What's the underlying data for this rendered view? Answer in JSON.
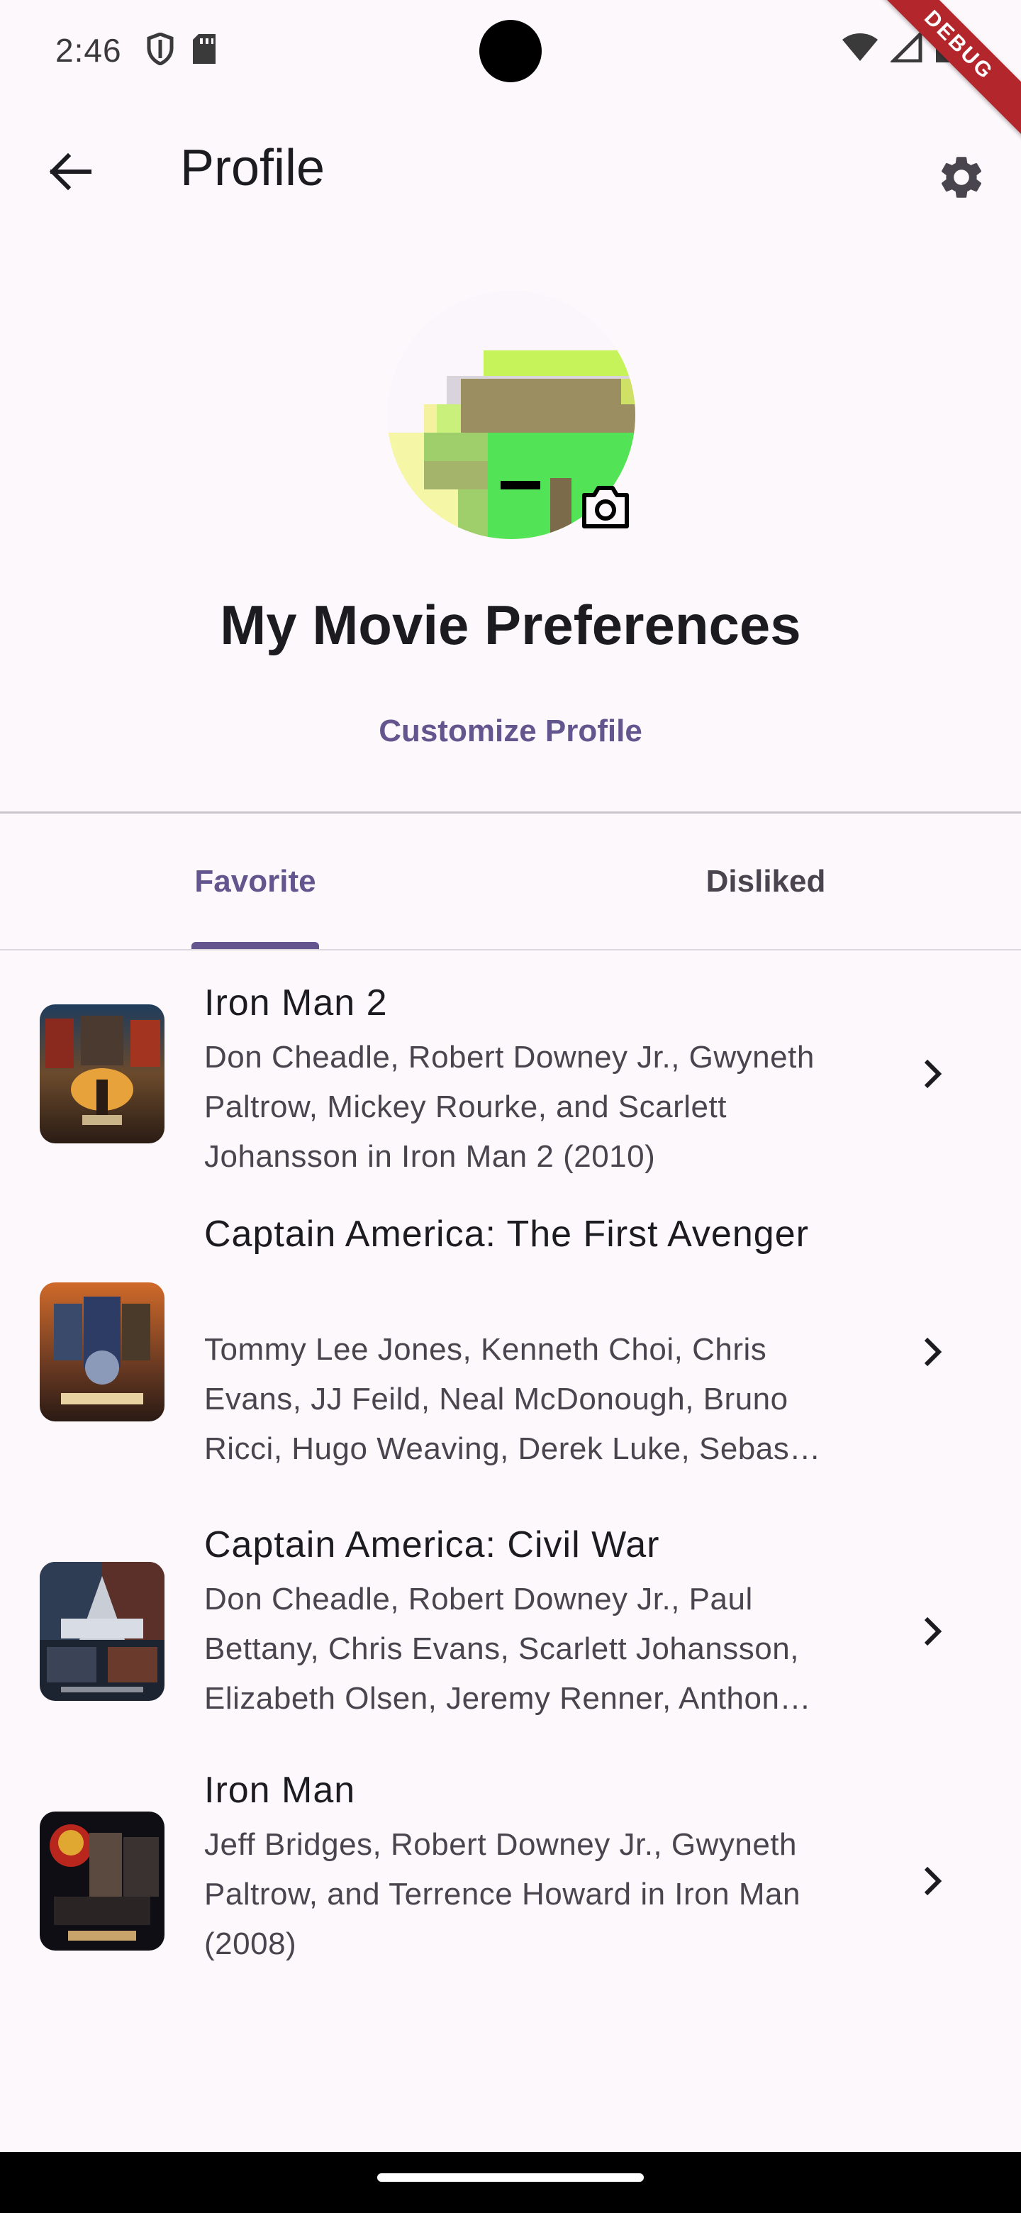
{
  "status_bar": {
    "time": "2:46",
    "debug_label": "DEBUG"
  },
  "app_bar": {
    "title": "Profile"
  },
  "profile": {
    "name": "My Movie Preferences",
    "customize_label": "Customize Profile"
  },
  "tabs": [
    {
      "label": "Favorite",
      "selected": true
    },
    {
      "label": "Disliked",
      "selected": false
    }
  ],
  "movies": [
    {
      "title": "Iron Man 2",
      "description": "Don Cheadle, Robert Downey Jr., Gwyneth Paltrow, Mickey Rourke, and Scarlett Johansson in Iron Man 2 (2010)"
    },
    {
      "title": "Captain America: The First Avenger",
      "description": "Tommy Lee Jones, Kenneth Choi, Chris Evans, JJ Feild, Neal McDonough, Bruno Ricci, Hugo Weaving, Derek Luke, Sebas…"
    },
    {
      "title": "Captain America: Civil War",
      "description": "Don Cheadle, Robert Downey Jr., Paul Bettany, Chris Evans, Scarlett Johansson, Elizabeth Olsen, Jeremy Renner, Anthon…"
    },
    {
      "title": "Iron Man",
      "description": "Jeff Bridges, Robert Downey Jr., Gwyneth Paltrow, and Terrence Howard in Iron Man (2008)"
    }
  ],
  "colors": {
    "accent": "#65558f",
    "background": "#fdf8fc",
    "debug_ribbon": "#b3262c"
  },
  "icons": {
    "back": "arrow-back-icon",
    "settings": "gear-icon",
    "camera": "camera-icon",
    "chevron": "chevron-right-icon"
  }
}
